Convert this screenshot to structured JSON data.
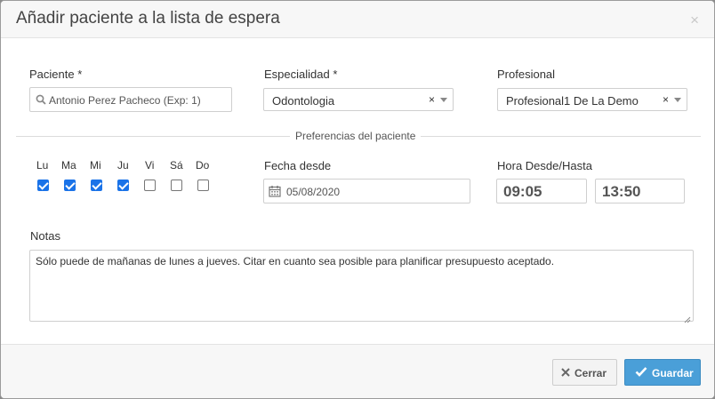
{
  "dialog": {
    "title": "Añadir paciente a la lista de espera",
    "close_glyph": "×"
  },
  "paciente": {
    "label": "Paciente *",
    "value": "Antonio Perez Pacheco (Exp: 1)",
    "icon": "search-icon"
  },
  "especialidad": {
    "label": "Especialidad *",
    "value": "Odontologia",
    "clear_glyph": "×"
  },
  "profesional": {
    "label": "Profesional",
    "value": "Profesional1 De La Demo",
    "clear_glyph": "×"
  },
  "preferencias": {
    "title": "Preferencias del paciente",
    "days": [
      {
        "label": "Lu",
        "checked": true
      },
      {
        "label": "Ma",
        "checked": true
      },
      {
        "label": "Mi",
        "checked": true
      },
      {
        "label": "Ju",
        "checked": true
      },
      {
        "label": "Vi",
        "checked": false
      },
      {
        "label": "Sá",
        "checked": false
      },
      {
        "label": "Do",
        "checked": false
      }
    ],
    "fecha_label": "Fecha desde",
    "fecha_value": "05/08/2020",
    "hora_label": "Hora Desde/Hasta",
    "hora_desde": "09:05",
    "hora_hasta": "13:50"
  },
  "notas": {
    "label": "Notas",
    "value": "Sólo puede de mañanas de lunes a jueves.  Citar en cuanto sea posible para planificar presupuesto aceptado."
  },
  "footer": {
    "cerrar_label": "Cerrar",
    "guardar_label": "Guardar"
  },
  "colors": {
    "checkbox_checked": "#1a73e8",
    "primary_button": "#4a9fd8"
  }
}
